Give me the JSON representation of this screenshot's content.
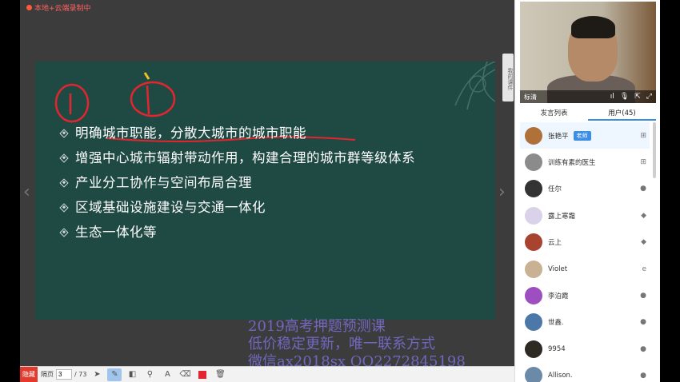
{
  "recording": {
    "label": "本地+云端录制中"
  },
  "slide": {
    "bullets": [
      "明确城市职能，分散大城市的城市职能",
      "增强中心城市辐射带动作用，构建合理的城市群等级体系",
      "产业分工协作与空间布局合理",
      "区域基础设施建设与交通一体化",
      "生态一体化等"
    ]
  },
  "courseware_tab": {
    "label": "我的课件"
  },
  "watermark": {
    "lines": [
      "2019高考押题预测课",
      "低价稳定更新，唯一联系方式",
      "微信ax2018sx QQ2272845198"
    ]
  },
  "toolbar": {
    "badge": "隐藏",
    "page_label": "隔页",
    "page_value": "3",
    "page_total": "/ 73"
  },
  "video": {
    "quality": "标清"
  },
  "tabs": {
    "chat": "发言列表",
    "users": "用户(45)"
  },
  "users": [
    {
      "name": "张艳平",
      "badge": "老师",
      "platform": "windows-icon",
      "color": "#b0703a"
    },
    {
      "name": "训练有素的医生",
      "badge": "",
      "platform": "windows-icon",
      "color": "#8b8b8b"
    },
    {
      "name": "任尔",
      "badge": "",
      "platform": "apple-icon",
      "color": "#333333"
    },
    {
      "name": "露上寒霜",
      "badge": "",
      "platform": "android-icon",
      "color": "#d9d2e8"
    },
    {
      "name": "云上",
      "badge": "",
      "platform": "android-icon",
      "color": "#a8432f"
    },
    {
      "name": "Violet",
      "badge": "",
      "platform": "ie-icon",
      "color": "#c9b294"
    },
    {
      "name": "李泊霞",
      "badge": "",
      "platform": "apple-icon",
      "color": "#9d4fc2"
    },
    {
      "name": "世鑫.",
      "badge": "",
      "platform": "apple-icon",
      "color": "#4b78a8"
    },
    {
      "name": "9954",
      "badge": "",
      "platform": "apple-icon",
      "color": "#2d2a24"
    },
    {
      "name": "Allison.",
      "badge": "",
      "platform": "apple-icon",
      "color": "#6b8aa8"
    }
  ]
}
